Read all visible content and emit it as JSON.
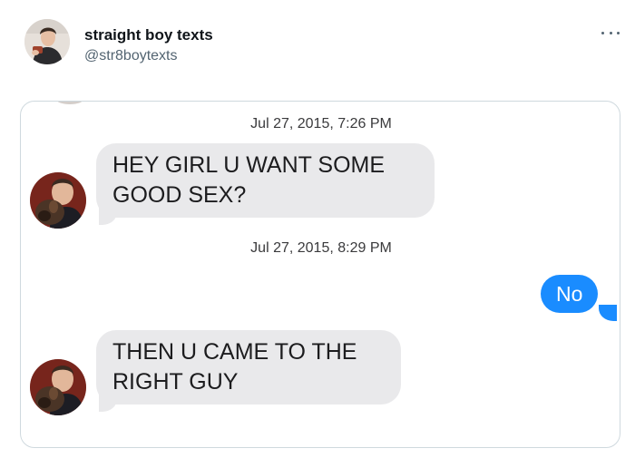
{
  "tweet": {
    "display_name": "straight boy texts",
    "handle": "@str8boytexts",
    "avatar_icon": "profile-photo",
    "more_icon": "ellipsis-icon"
  },
  "conversation": {
    "timestamp_1": "Jul 27, 2015, 7:26 PM",
    "incoming_1": [
      "HEY GIRL U WANT SOME",
      "GOOD SEX?"
    ],
    "timestamp_2": "Jul 27, 2015, 8:29 PM",
    "outgoing_1": "No",
    "incoming_2": [
      "THEN U CAME TO THE",
      "RIGHT GUY"
    ]
  },
  "colors": {
    "incoming_bubble": "#e9e9eb",
    "outgoing_bubble": "#1a8cff",
    "handle_text": "#536471"
  }
}
